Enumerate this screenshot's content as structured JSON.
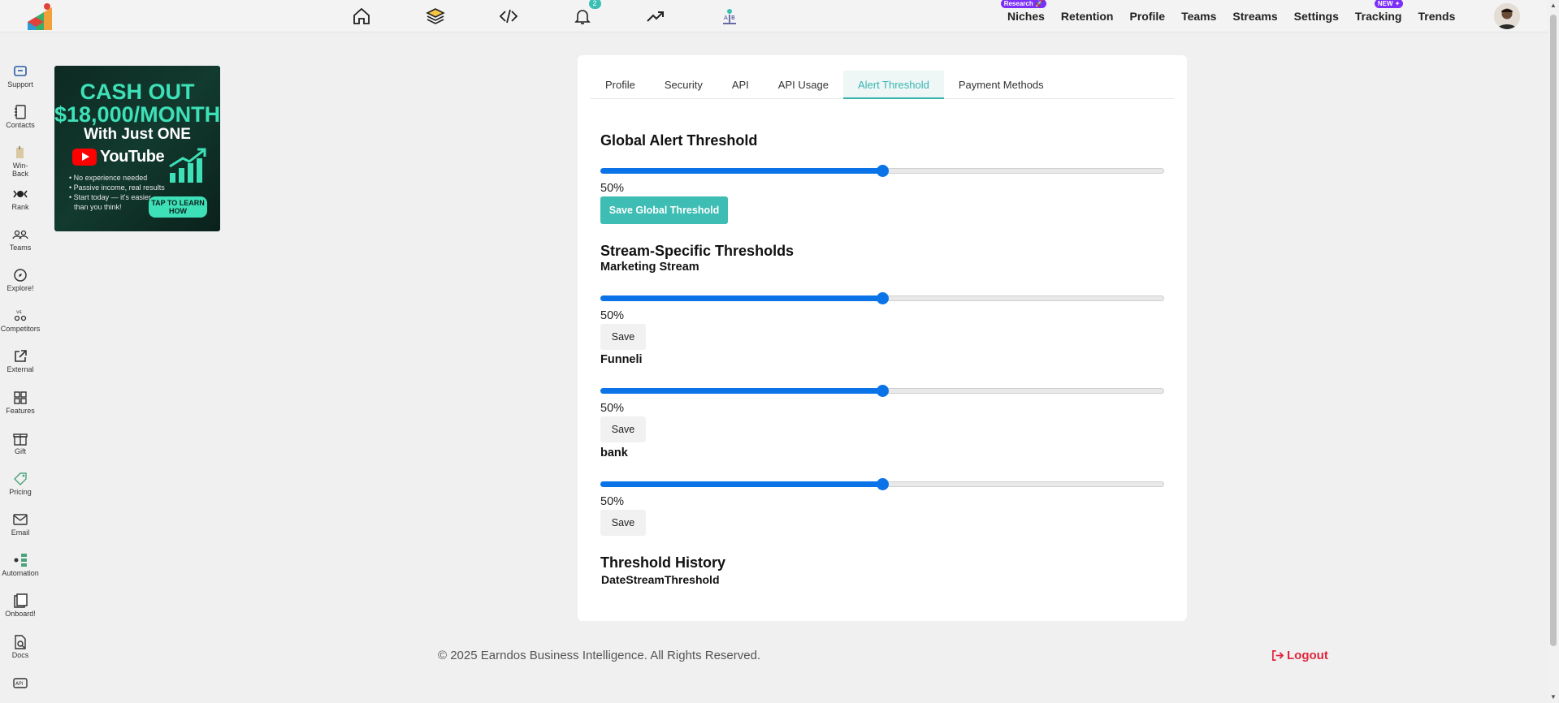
{
  "topbar": {
    "nav_icons": [
      {
        "name": "home-icon",
        "badge": null
      },
      {
        "name": "layers-icon",
        "badge": null
      },
      {
        "name": "code-icon",
        "badge": null
      },
      {
        "name": "bell-icon",
        "badge": "2"
      },
      {
        "name": "trending-icon",
        "badge": null
      },
      {
        "name": "ab-test-icon",
        "badge": null
      }
    ],
    "links": [
      {
        "label": "Niches",
        "tag": "Research 🚀"
      },
      {
        "label": "Retention",
        "tag": null
      },
      {
        "label": "Profile",
        "tag": null
      },
      {
        "label": "Teams",
        "tag": null
      },
      {
        "label": "Streams",
        "tag": null
      },
      {
        "label": "Settings",
        "tag": null
      },
      {
        "label": "Tracking",
        "tag": "NEW ✦"
      },
      {
        "label": "Trends",
        "tag": null
      }
    ]
  },
  "sidebar": {
    "items": [
      {
        "label": "Support",
        "icon": "support-icon"
      },
      {
        "label": "Contacts",
        "icon": "contacts-icon"
      },
      {
        "label": "Win-\nBack",
        "icon": "winback-icon"
      },
      {
        "label": "Rank",
        "icon": "rank-icon"
      },
      {
        "label": "Teams",
        "icon": "teams-icon"
      },
      {
        "label": "Explore!",
        "icon": "explore-icon"
      },
      {
        "label": "Competitors",
        "icon": "competitors-icon"
      },
      {
        "label": "External",
        "icon": "external-icon"
      },
      {
        "label": "Features",
        "icon": "features-icon"
      },
      {
        "label": "Gift",
        "icon": "gift-icon"
      },
      {
        "label": "Pricing",
        "icon": "pricing-icon"
      },
      {
        "label": "Email",
        "icon": "email-icon"
      },
      {
        "label": "Automation",
        "icon": "automation-icon"
      },
      {
        "label": "Onboard!",
        "icon": "onboard-icon"
      },
      {
        "label": "Docs",
        "icon": "docs-icon"
      },
      {
        "label": "",
        "icon": "api-icon"
      }
    ]
  },
  "ad": {
    "headline": "CASH OUT $18,000/MONTH",
    "subline": "With Just ONE",
    "brand": "YouTube",
    "bullets": [
      "• No experience needed",
      "• Passive income, real results",
      "• Start today — it's easier",
      "  than you think!"
    ],
    "cta": "TAP TO LEARN HOW"
  },
  "settings": {
    "tabs": [
      {
        "label": "Profile",
        "active": false
      },
      {
        "label": "Security",
        "active": false
      },
      {
        "label": "API",
        "active": false
      },
      {
        "label": "API Usage",
        "active": false
      },
      {
        "label": "Alert Threshold",
        "active": true
      },
      {
        "label": "Payment Methods",
        "active": false
      }
    ],
    "global": {
      "title": "Global Alert Threshold",
      "value": 50,
      "value_label": "50%",
      "button": "Save Global Threshold"
    },
    "stream_section_title": "Stream-Specific Thresholds",
    "streams": [
      {
        "name": "Marketing Stream",
        "value": 50,
        "value_label": "50%",
        "button": "Save"
      },
      {
        "name": "Funneli",
        "value": 50,
        "value_label": "50%",
        "button": "Save"
      },
      {
        "name": "bank",
        "value": 50,
        "value_label": "50%",
        "button": "Save"
      }
    ],
    "history": {
      "title": "Threshold History",
      "columns": [
        "Date",
        "Stream",
        "Threshold"
      ]
    }
  },
  "footer": {
    "copyright": "© 2025 Earndos Business Intelligence. All Rights Reserved.",
    "logout": "Logout"
  },
  "colors": {
    "accent": "#3dbdb3",
    "slider": "#0a73e8",
    "logout": "#e0263d",
    "ad_green": "#3ee0b8"
  }
}
